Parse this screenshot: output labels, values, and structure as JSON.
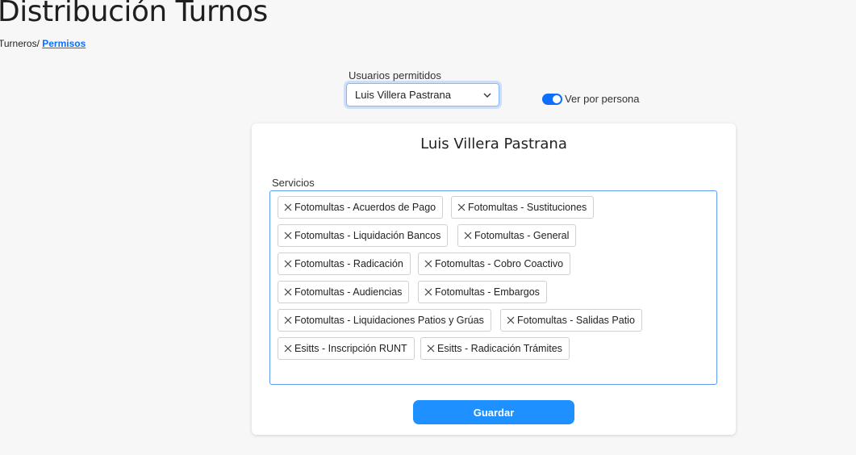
{
  "header": {
    "title": "Distribución Turnos",
    "breadcrumb_root": "Turneros/",
    "breadcrumb_current": "Permisos"
  },
  "filters": {
    "users_label": "Usuarios permitidos",
    "selected_user": "Luis Villera Pastrana",
    "toggle_label": "Ver por persona",
    "toggle_on": true
  },
  "card": {
    "title": "Luis Villera Pastrana",
    "services_label": "Servicios",
    "tags": [
      "Fotomultas - Acuerdos de Pago",
      "Fotomultas - Sustituciones",
      "Fotomultas - Liquidación Bancos",
      "Fotomultas - General",
      "Fotomultas - Radicación",
      "Fotomultas - Cobro Coactivo",
      "Fotomultas - Audiencias",
      "Fotomultas - Embargos",
      "Fotomultas - Liquidaciones Patios y Grúas",
      "Fotomultas - Salidas Patio",
      "Esitts - Inscripción RUNT",
      "Esitts - Radicación Trámites"
    ],
    "save_label": "Guardar"
  },
  "colors": {
    "accent": "#0d6efd",
    "button": "#1e90ff"
  },
  "icons": {
    "select_chevron": "chevron-down-icon",
    "tag_remove": "close-icon"
  }
}
